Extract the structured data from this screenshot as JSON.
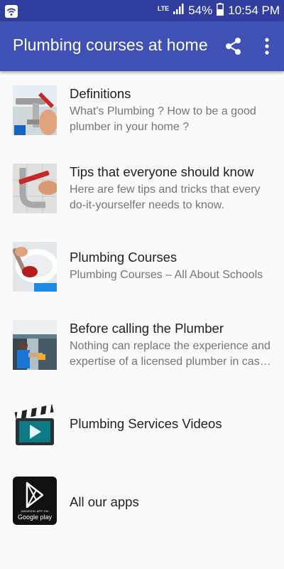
{
  "status_bar": {
    "network": "LTE",
    "battery": "54%",
    "time": "10:54 PM"
  },
  "app_bar": {
    "title": "Plumbing courses at home",
    "share_icon": "share-icon",
    "more_icon": "more-vert-icon"
  },
  "items": [
    {
      "title": "Definitions",
      "subtitle": "What's Plumbing ? How to be a good plumber in your home ?",
      "icon": "plumber-wrench-photo"
    },
    {
      "title": "Tips that everyone should know",
      "subtitle": "Here are few tips and tricks that every do-it-yourselfer needs to know.",
      "icon": "pipe-wrench-photo"
    },
    {
      "title": "Plumbing Courses",
      "subtitle": "Plumbing Courses – All About Schools",
      "icon": "plunger-photo"
    },
    {
      "title": "Before calling the Plumber",
      "subtitle": "Nothing can replace the experience and expertise of a licensed plumber in case of emergency.",
      "icon": "plumber-under-sink-photo"
    },
    {
      "title": "Plumbing Services Videos",
      "subtitle": "",
      "icon": "video-clapper-icon"
    },
    {
      "title": "All our apps",
      "subtitle": "",
      "icon": "google-play-icon",
      "badge_small": "ANDROID APP ON",
      "badge_big": "Google play"
    }
  ],
  "colors": {
    "primary": "#3f51b5",
    "primary_dark": "#303f9f",
    "title_text": "#212121",
    "subtitle_text": "#757575"
  }
}
